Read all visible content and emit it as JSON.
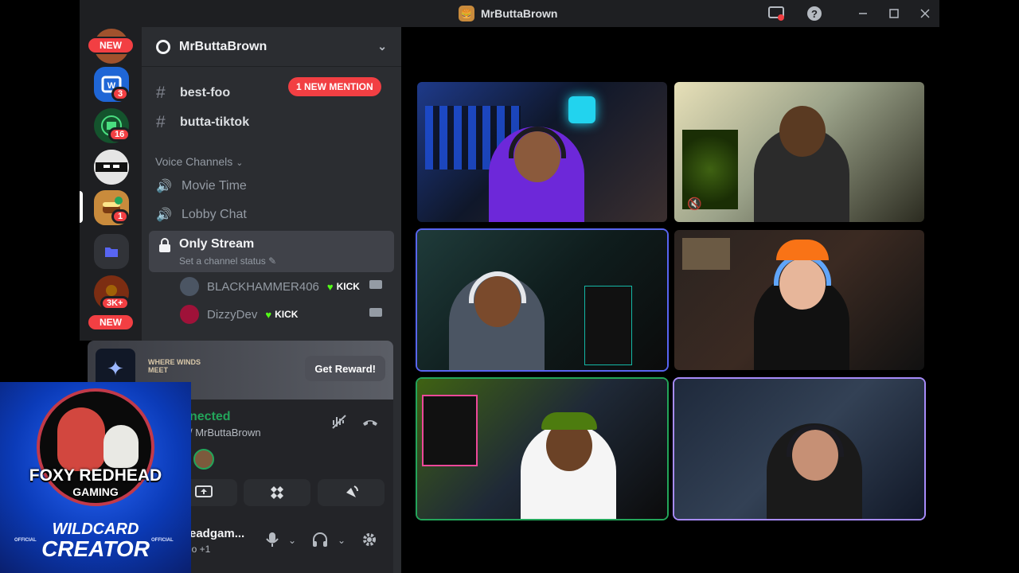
{
  "window": {
    "title": "MrButtaBrown"
  },
  "rail": {
    "new_top": "NEW",
    "new_bottom": "NEW",
    "badges": [
      "3",
      "16",
      "1",
      "3K+"
    ]
  },
  "server": {
    "name": "MrButtaBrown"
  },
  "channels": {
    "text": [
      {
        "label": "best-foo"
      },
      {
        "label": "butta-tiktok"
      }
    ],
    "mention_pill": "1 NEW MENTION",
    "voice_category": "Voice Channels",
    "voice": [
      {
        "label": "Movie Time"
      },
      {
        "label": "Lobby Chat"
      }
    ],
    "active_voice": {
      "label": "Only Stream",
      "status": "Set a channel status"
    },
    "members": [
      {
        "name": "BLACKHAMMER406",
        "tag": "KICK"
      },
      {
        "name": "DizzyDev",
        "tag": "KICK"
      }
    ]
  },
  "promo": {
    "game": "WHERE WINDS MEET",
    "button": "Get Reward!"
  },
  "voice_panel": {
    "state": "nected",
    "where": "/ MrButtaBrown"
  },
  "user_panel": {
    "name": "eadgam...",
    "sub": "io +1"
  },
  "overlay": {
    "line1": "FOXY REDHEAD",
    "line2": "GAMING",
    "line3": "WILDCARD",
    "line4": "CREATOR",
    "official": "OFFICIAL"
  },
  "colors": {
    "accent": "#5865f2",
    "danger": "#f23f43",
    "online": "#23a55a",
    "kick": "#53fc18"
  },
  "icons": [
    "cog-icon",
    "chevron-down-icon",
    "hash-icon",
    "speaker-icon",
    "lock-icon",
    "pencil-icon",
    "camera-icon",
    "mute-icon",
    "help-icon",
    "minimize-icon",
    "maximize-icon",
    "close-icon",
    "disconnect-icon",
    "screen-share-icon",
    "activity-icon",
    "soundboard-icon",
    "microphone-icon",
    "headphones-icon",
    "settings-icon"
  ]
}
